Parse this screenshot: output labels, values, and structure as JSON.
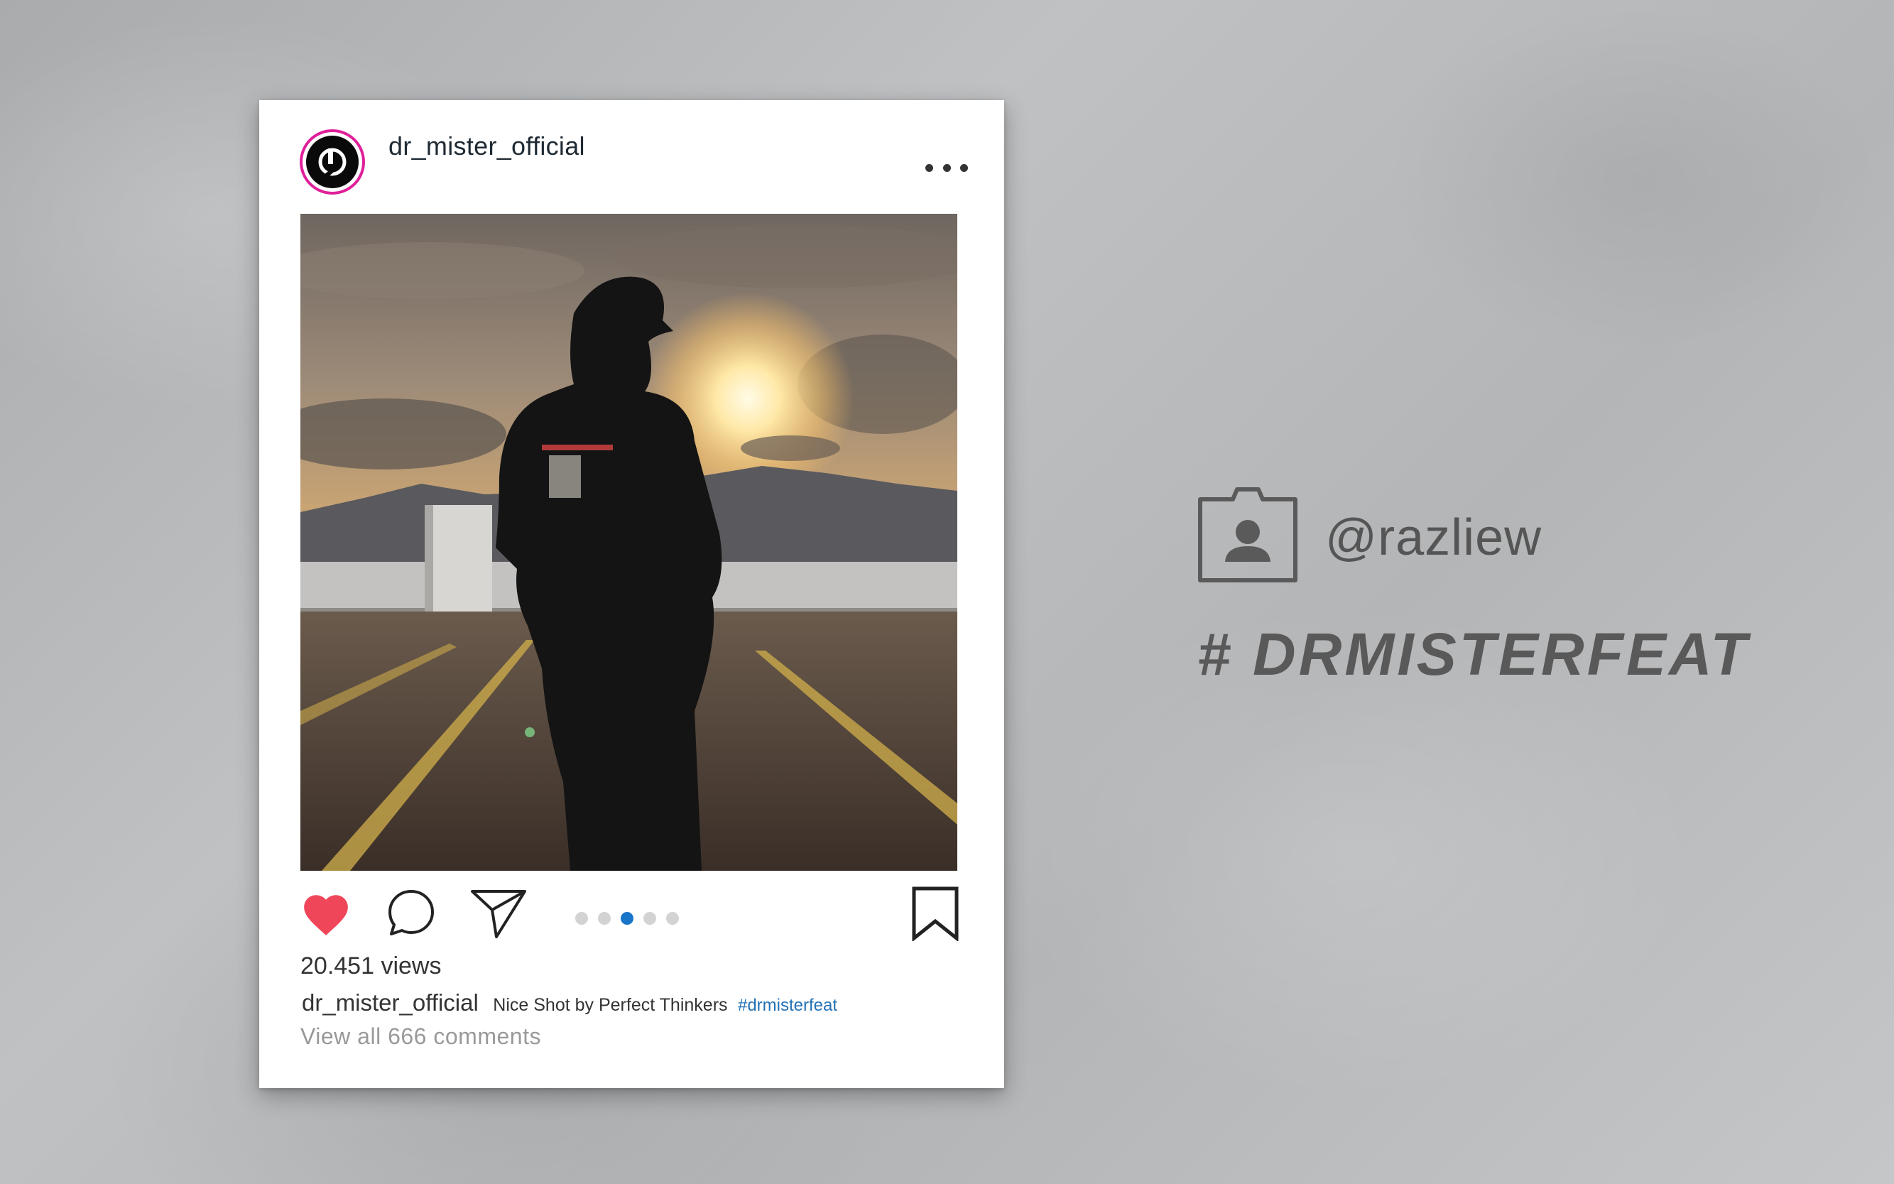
{
  "post": {
    "username": "dr_mister_official",
    "views": "20.451 views",
    "caption_user": "dr_mister_official",
    "caption_text": "Nice Shot by Perfect Thinkers",
    "caption_tag": "#drmisterfeat",
    "comments_link": "View all 666 comments",
    "carousel": {
      "count": 5,
      "active_index": 2
    },
    "liked": true
  },
  "credits": {
    "handle": "@razliew",
    "hashtag": "# DRMISTERFEAT"
  },
  "colors": {
    "like": "#f0465a",
    "carousel_active": "#1875c8",
    "hashtag_link": "#2472b5",
    "avatar_ring": "#e0209a"
  },
  "icons": {
    "like": "heart-icon",
    "comment": "comment-bubble-icon",
    "share": "paper-plane-icon",
    "save": "bookmark-icon",
    "more": "more-dots-icon",
    "profile": "profile-badge-icon"
  }
}
